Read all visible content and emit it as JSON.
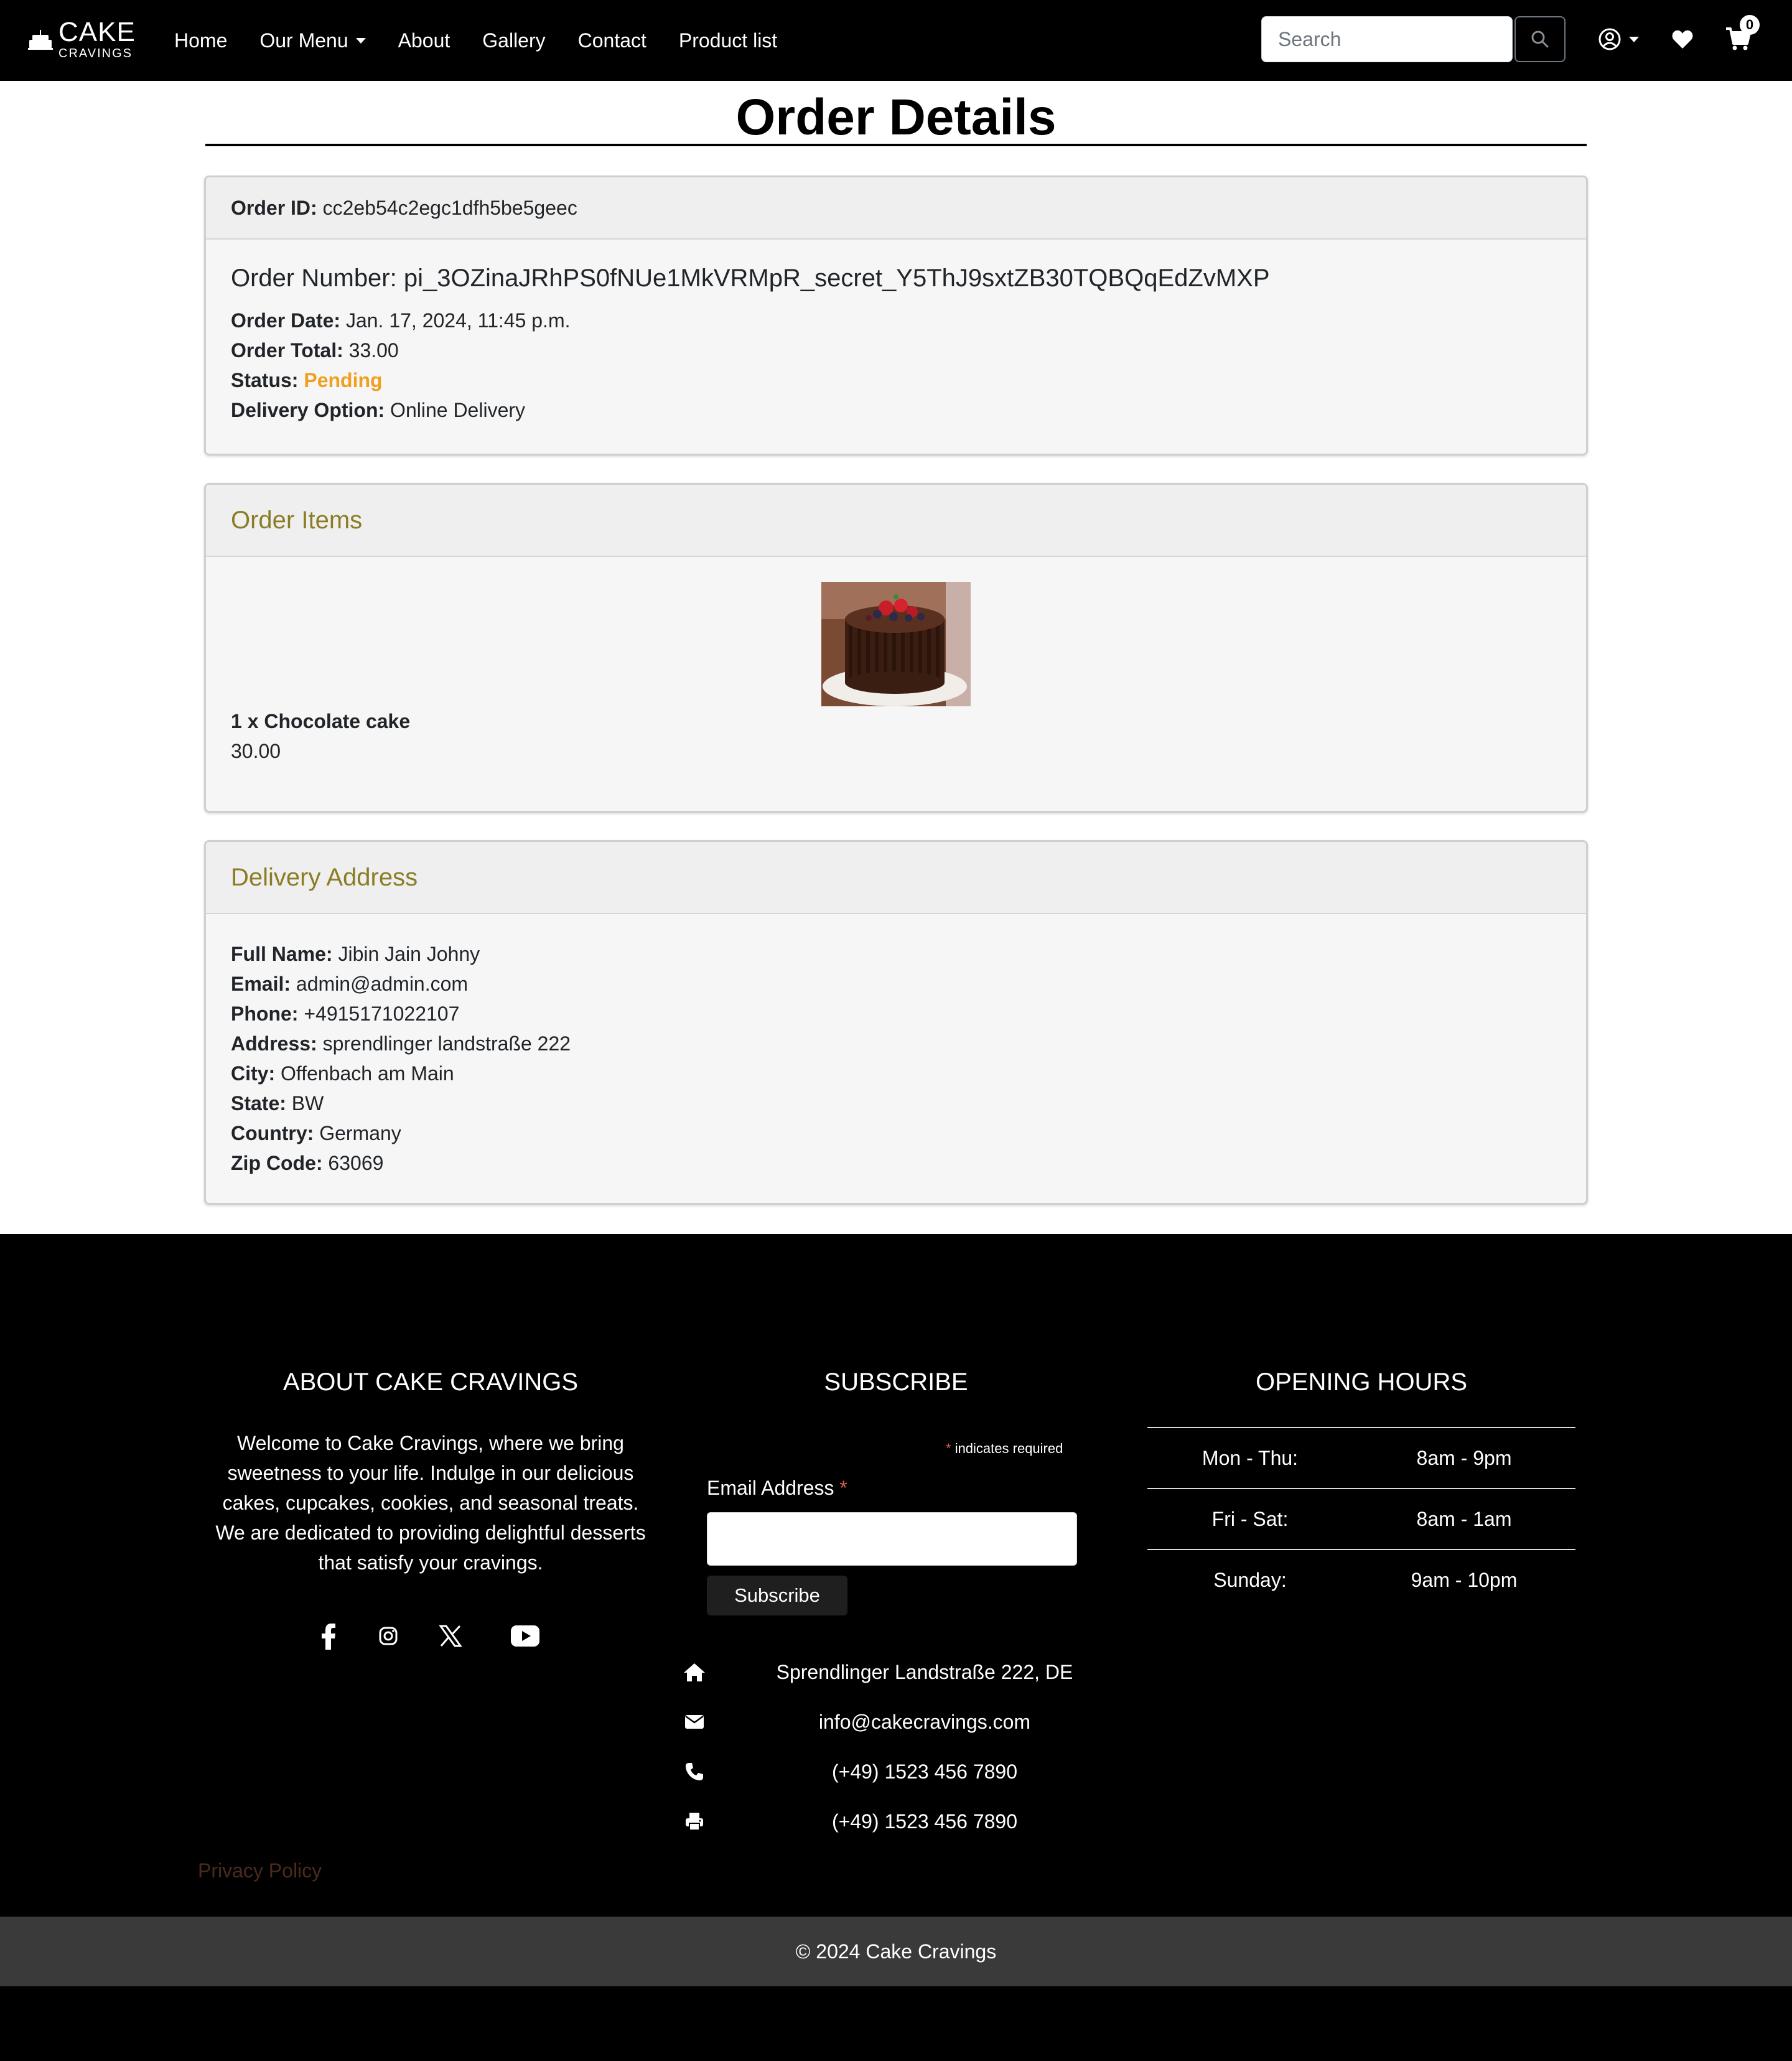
{
  "brand": {
    "name_big": "CAKE",
    "name_small": "CRAVINGS"
  },
  "nav": {
    "items": [
      {
        "label": "Home"
      },
      {
        "label": "Our Menu",
        "dropdown": true
      },
      {
        "label": "About"
      },
      {
        "label": "Gallery"
      },
      {
        "label": "Contact"
      },
      {
        "label": "Product list"
      }
    ],
    "search_placeholder": "Search",
    "cart_count": "0"
  },
  "page": {
    "title": "Order Details"
  },
  "order": {
    "id_label": "Order ID:",
    "id_value": "cc2eb54c2egc1dfh5be5geec",
    "number_label": "Order Number:",
    "number_value": "pi_3OZinaJRhPS0fNUe1MkVRMpR_secret_Y5ThJ9sxtZB30TQBQqEdZvMXP",
    "date_label": "Order Date:",
    "date_value": "Jan. 17, 2024, 11:45 p.m.",
    "total_label": "Order Total:",
    "total_value": "33.00",
    "status_label": "Status:",
    "status_value": "Pending",
    "delivery_label": "Delivery Option:",
    "delivery_value": "Online Delivery"
  },
  "items_section": {
    "title": "Order Items",
    "items": [
      {
        "name": "1 x Chocolate cake",
        "price": "30.00"
      }
    ]
  },
  "address_section": {
    "title": "Delivery Address",
    "fields": [
      {
        "label": "Full Name:",
        "value": "Jibin Jain Johny"
      },
      {
        "label": "Email:",
        "value": "admin@admin.com"
      },
      {
        "label": "Phone:",
        "value": "+4915171022107"
      },
      {
        "label": "Address:",
        "value": "sprendlinger landstraße 222"
      },
      {
        "label": "City:",
        "value": "Offenbach am Main"
      },
      {
        "label": "State:",
        "value": "BW"
      },
      {
        "label": "Country:",
        "value": "Germany"
      },
      {
        "label": "Zip Code:",
        "value": "63069"
      }
    ]
  },
  "footer": {
    "about_title": "ABOUT CAKE CRAVINGS",
    "about_text": "Welcome to Cake Cravings, where we bring sweetness to your life. Indulge in our delicious cakes, cupcakes, cookies, and seasonal treats. We are dedicated to providing delightful desserts that satisfy your cravings.",
    "subscribe_title": "SUBSCRIBE",
    "required_note": "indicates required",
    "email_label": "Email Address",
    "subscribe_button": "Subscribe",
    "contacts": [
      {
        "icon": "home-icon",
        "text": "Sprendlinger Landstraße 222, DE"
      },
      {
        "icon": "envelope-icon",
        "text": "info@cakecravings.com"
      },
      {
        "icon": "phone-icon",
        "text": "(+49) 1523 456 7890"
      },
      {
        "icon": "printer-icon",
        "text": "(+49) 1523 456 7890"
      }
    ],
    "hours_title": "OPENING HOURS",
    "hours": [
      {
        "day": "Mon - Thu:",
        "time": "8am - 9pm"
      },
      {
        "day": "Fri - Sat:",
        "time": "8am - 1am"
      },
      {
        "day": "Sunday:",
        "time": "9am - 10pm"
      }
    ],
    "privacy": "Privacy Policy",
    "copyright": "© 2024 Cake Cravings"
  },
  "colors": {
    "status_pending": "#f0a01e",
    "section_title": "#8b7d25",
    "privacy_link": "#4b2a1e"
  }
}
